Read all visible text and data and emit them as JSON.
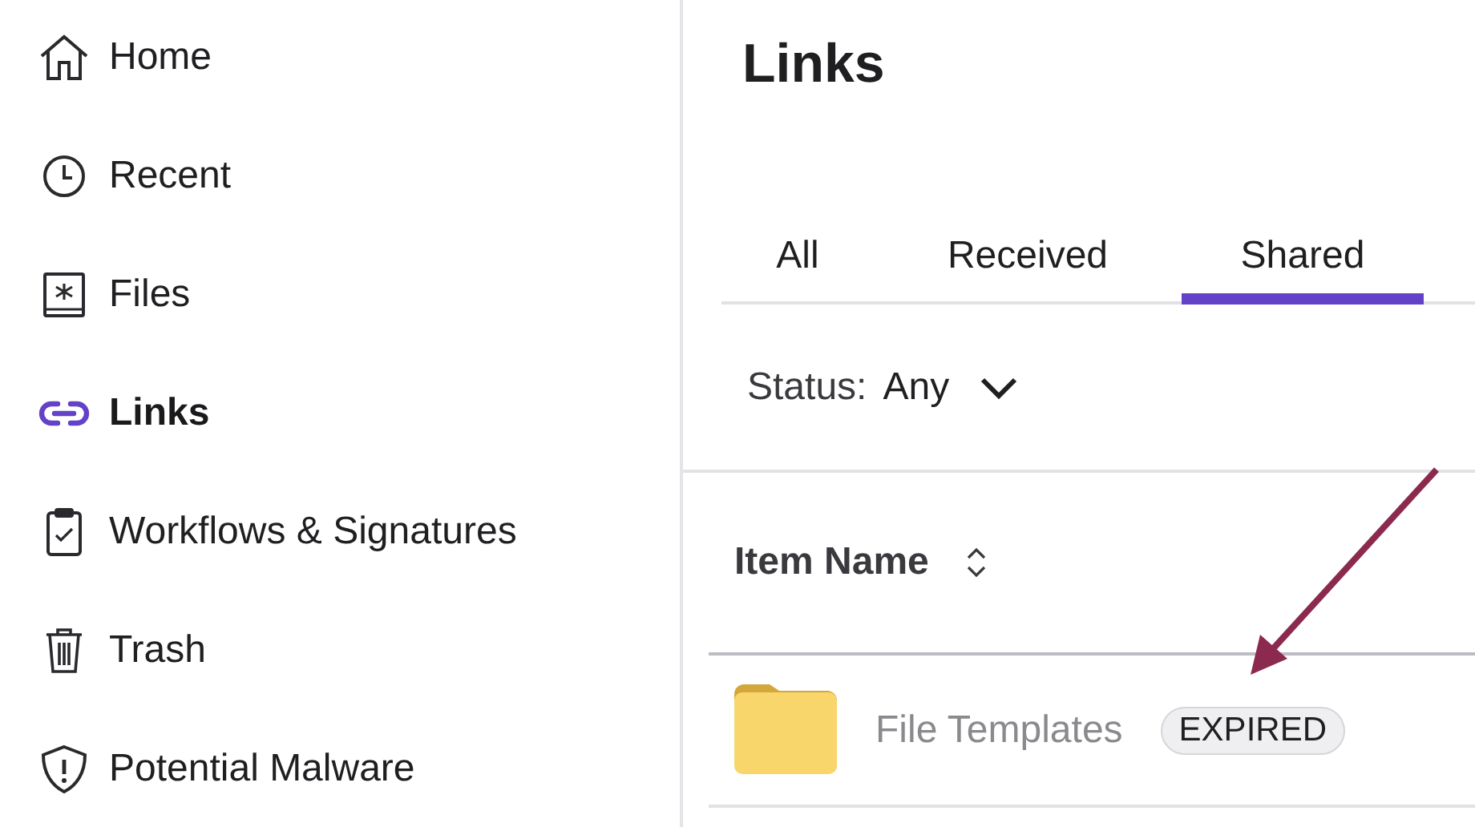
{
  "sidebar": {
    "items": [
      {
        "label": "Home",
        "selected": false
      },
      {
        "label": "Recent",
        "selected": false
      },
      {
        "label": "Files",
        "selected": false
      },
      {
        "label": "Links",
        "selected": true
      },
      {
        "label": "Workflows & Signatures",
        "selected": false
      },
      {
        "label": "Trash",
        "selected": false
      },
      {
        "label": "Potential Malware",
        "selected": false
      }
    ]
  },
  "page_title": "Links",
  "tabs": [
    {
      "label": "All",
      "selected": false
    },
    {
      "label": "Received",
      "selected": false
    },
    {
      "label": "Shared",
      "selected": true
    }
  ],
  "filter": {
    "label": "Status:",
    "value": "Any"
  },
  "table": {
    "columns": [
      {
        "label": "Item Name"
      }
    ],
    "rows": [
      {
        "name": "File Templates",
        "badge": "EXPIRED"
      }
    ]
  }
}
